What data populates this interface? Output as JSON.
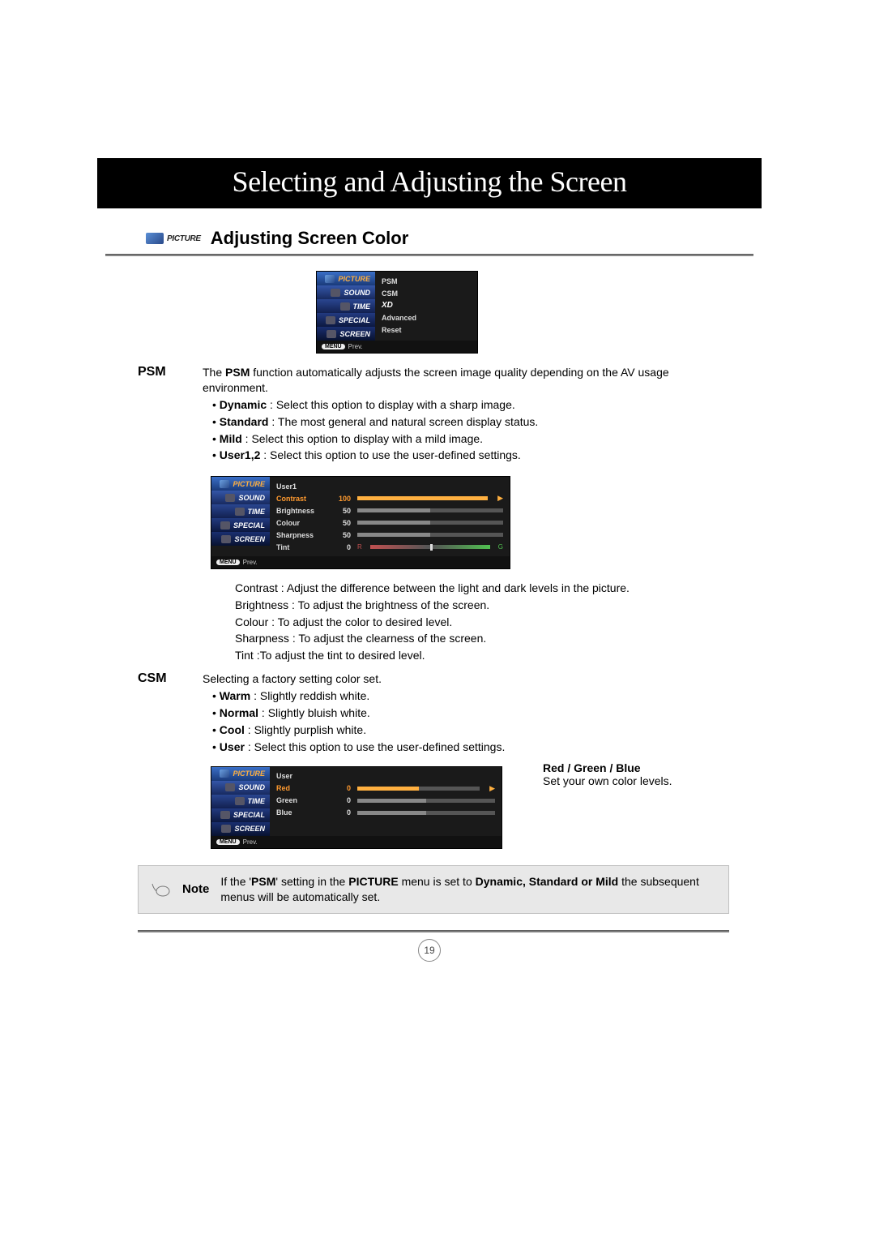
{
  "banner": "Selecting and Adjusting the Screen",
  "picture_label": "PICTURE",
  "section_title": "Adjusting Screen Color",
  "osd": {
    "tabs": [
      "PICTURE",
      "SOUND",
      "TIME",
      "SPECIAL",
      "SCREEN"
    ],
    "menu1": {
      "items": [
        "PSM",
        "CSM",
        "XD",
        "Advanced",
        "Reset"
      ]
    },
    "menu2": {
      "title": "User1",
      "rows": [
        {
          "label": "Contrast",
          "value": 100,
          "pct": 100,
          "selected": true
        },
        {
          "label": "Brightness",
          "value": 50,
          "pct": 50
        },
        {
          "label": "Colour",
          "value": 50,
          "pct": 50
        },
        {
          "label": "Sharpness",
          "value": 50,
          "pct": 50
        },
        {
          "label": "Tint",
          "value": 0,
          "tint": true
        }
      ]
    },
    "menu3": {
      "title": "User",
      "rows": [
        {
          "label": "Red",
          "value": 0,
          "pct": 50,
          "selected": true
        },
        {
          "label": "Green",
          "value": 0,
          "pct": 50
        },
        {
          "label": "Blue",
          "value": 0,
          "pct": 50
        }
      ]
    },
    "prev": "Prev.",
    "menu_btn": "MENU"
  },
  "psm": {
    "label": "PSM",
    "intro_a": "The ",
    "intro_b": "PSM",
    "intro_c": " function automatically adjusts the screen image quality depending on the AV usage environment.",
    "bullets": [
      {
        "term": "Dynamic",
        "desc": " : Select this option to display with a sharp image."
      },
      {
        "term": "Standard",
        "desc": " : The most general and natural screen display status."
      },
      {
        "term": "Mild",
        "desc": " : Select this option to display with a mild image."
      },
      {
        "term": "User1,2",
        "desc": " : Select this option to use the user-defined settings."
      }
    ],
    "sub": [
      {
        "term": "Contrast",
        "desc": " : Adjust the difference between the light and dark levels in the picture."
      },
      {
        "term": "Brightness",
        "desc": " : To adjust the brightness of the screen."
      },
      {
        "term": "Colour",
        "desc": " : To adjust the color to desired level."
      },
      {
        "term": "Sharpness",
        "desc": " : To adjust the clearness of the screen."
      },
      {
        "term": "Tint",
        "desc": " :To adjust the tint to desired level."
      }
    ]
  },
  "csm": {
    "label": "CSM",
    "intro": "Selecting a factory setting color set.",
    "bullets": [
      {
        "term": "Warm",
        "desc": " : Slightly reddish white."
      },
      {
        "term": "Normal",
        "desc": " : Slightly bluish white."
      },
      {
        "term": "Cool",
        "desc": " : Slightly purplish white."
      },
      {
        "term": "User",
        "desc": " : Select this option to use the user-defined settings."
      }
    ],
    "rgb_title": "Red / Green / Blue",
    "rgb_desc": "Set your own color levels."
  },
  "note": {
    "label": "Note",
    "t1": "If the '",
    "t2": "PSM",
    "t3": "' setting in the ",
    "t4": "PICTURE",
    "t5": " menu is set to ",
    "t6": "Dynamic, Standard or Mild",
    "t7": " the subsequent menus will be automatically set."
  },
  "page_number": "19"
}
